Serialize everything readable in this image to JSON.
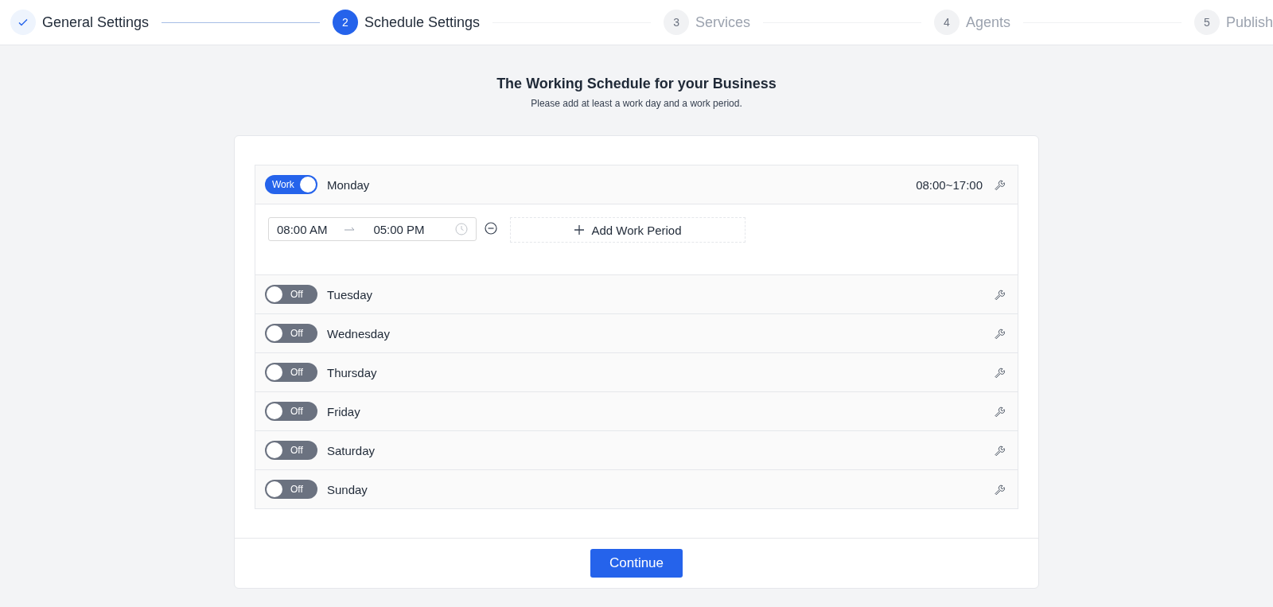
{
  "steps": [
    {
      "label": "General Settings",
      "completed": true,
      "selected": false
    },
    {
      "number": "2",
      "label": "Schedule Settings",
      "completed": false,
      "selected": true
    },
    {
      "number": "3",
      "label": "Services",
      "completed": false,
      "selected": false
    },
    {
      "number": "4",
      "label": "Agents",
      "completed": false,
      "selected": false
    },
    {
      "number": "5",
      "label": "Publish",
      "completed": false,
      "selected": false
    }
  ],
  "heading": {
    "title": "The Working Schedule for your Business",
    "subtitle": "Please add at least a work day and a work period."
  },
  "days": [
    {
      "name": "Monday",
      "on": true,
      "switch_label": "Work",
      "summary": "08:00~17:00",
      "expanded": true,
      "periods": [
        {
          "start": "08:00 AM",
          "end": "05:00 PM"
        }
      ],
      "add_label": "Add Work Period"
    },
    {
      "name": "Tuesday",
      "on": false,
      "switch_label": "Off",
      "expanded": false
    },
    {
      "name": "Wednesday",
      "on": false,
      "switch_label": "Off",
      "expanded": false
    },
    {
      "name": "Thursday",
      "on": false,
      "switch_label": "Off",
      "expanded": false
    },
    {
      "name": "Friday",
      "on": false,
      "switch_label": "Off",
      "expanded": false
    },
    {
      "name": "Saturday",
      "on": false,
      "switch_label": "Off",
      "expanded": false
    },
    {
      "name": "Sunday",
      "on": false,
      "switch_label": "Off",
      "expanded": false
    }
  ],
  "continue_button": "Continue"
}
